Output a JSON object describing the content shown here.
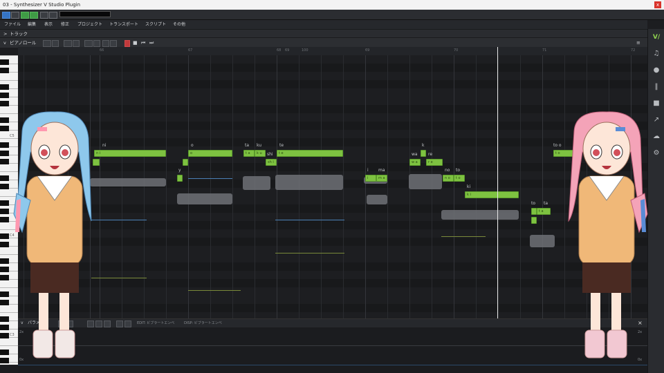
{
  "window": {
    "title": "03 - Synthesizer V Studio Plugin",
    "close_label": "x"
  },
  "host": {
    "input_value": ""
  },
  "menu": [
    "ファイル",
    "編集",
    "表示",
    "修正",
    "プロジェクト",
    "トランスポート",
    "スクリプト",
    "その他"
  ],
  "track_header": {
    "arrow": ">",
    "label": "トラック"
  },
  "piano_header": {
    "arrow": "v",
    "label": "ピアノロール"
  },
  "ruler": [
    "66",
    "67",
    "68",
    "69",
    "100",
    "69",
    "70",
    "71",
    "72"
  ],
  "piano_labels": [
    "C5",
    "C4",
    "C3"
  ],
  "notes": [
    {
      "lyric": "ni",
      "ph": "n i"
    },
    {
      "lyric": "o",
      "ph": "o"
    },
    {
      "lyric": "ta",
      "ph": "t a"
    },
    {
      "lyric": "ku",
      "ph": "k u"
    },
    {
      "lyric": "shi",
      "ph": "sh i"
    },
    {
      "lyric": "te",
      "ph": "t e"
    },
    {
      "lyric": "y",
      "ph": "y"
    },
    {
      "lyric": "i",
      "ph": "i"
    },
    {
      "lyric": "ma",
      "ph": "m a"
    },
    {
      "lyric": "wa",
      "ph": "w a"
    },
    {
      "lyric": "k",
      "ph": "k"
    },
    {
      "lyric": "re",
      "ph": "r e"
    },
    {
      "lyric": "no",
      "ph": "n o"
    },
    {
      "lyric": "to",
      "ph": "t o"
    },
    {
      "lyric": "ki",
      "ph": "k i"
    },
    {
      "lyric": "to",
      "ph": "t o"
    },
    {
      "lyric": "ta",
      "ph": "t a"
    },
    {
      "lyric": "to o",
      "ph": "t o"
    }
  ],
  "param_panel": {
    "label": "パラメ",
    "edit_label": "EDIT: ビブラートエンベ",
    "disp_label": "DISP: ビブラートエンベ",
    "scale_top_left": "2x",
    "scale_bottom_left": "0x",
    "scale_top_right": "2x",
    "scale_bottom_right": "0x",
    "close": "×"
  },
  "sidebar_icons": [
    "logo-icon",
    "note-icon",
    "microphone-icon",
    "library-icon",
    "panel-icon",
    "export-icon",
    "cloud-icon",
    "gear-icon"
  ],
  "colors": {
    "note_green": "#7ec241",
    "accent_red": "#c0393b",
    "host_blue": "#3574c4"
  }
}
